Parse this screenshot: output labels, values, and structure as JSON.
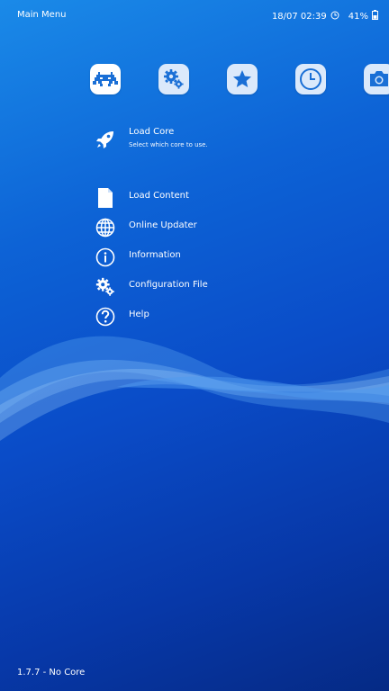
{
  "header": {
    "title": "Main Menu",
    "datetime": "18/07 02:39",
    "battery": "41%",
    "clock_icon": "clock-icon",
    "battery_icon": "battery-icon"
  },
  "tabs": [
    {
      "name": "main-menu",
      "icon": "gamepad-invader-icon",
      "active": true
    },
    {
      "name": "settings",
      "icon": "gears-icon",
      "active": false
    },
    {
      "name": "favorites",
      "icon": "star-icon",
      "active": false
    },
    {
      "name": "history",
      "icon": "clock-icon",
      "active": false
    },
    {
      "name": "images",
      "icon": "camera-icon",
      "active": false
    }
  ],
  "menu": {
    "load_core": {
      "label": "Load Core",
      "sublabel": "Select which core to use.",
      "icon": "rocket-icon"
    },
    "load_content": {
      "label": "Load Content",
      "icon": "file-icon"
    },
    "online_updater": {
      "label": "Online Updater",
      "icon": "globe-icon"
    },
    "information": {
      "label": "Information",
      "icon": "info-icon"
    },
    "configuration_file": {
      "label": "Configuration File",
      "icon": "gears-icon"
    },
    "help": {
      "label": "Help",
      "icon": "help-icon"
    }
  },
  "footer": {
    "version": "1.7.7 - No Core"
  },
  "colors": {
    "accent": "#1a7ae0",
    "background_top": "#1a8ae8",
    "background_bottom": "#052a85"
  }
}
